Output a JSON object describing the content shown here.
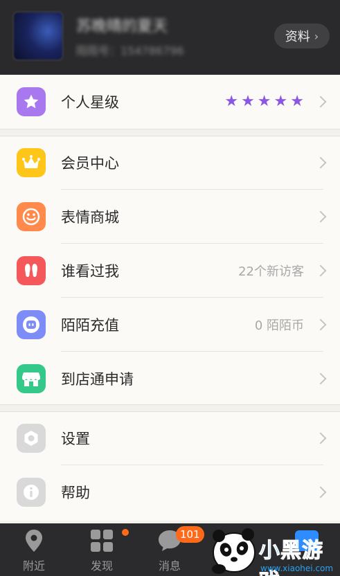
{
  "header": {
    "username": "苏晚晴的夏天",
    "user_id": "陌陌号：154786796",
    "profile_button": "资料"
  },
  "menu": {
    "star_level": {
      "label": "个人星级",
      "stars": 5
    },
    "vip_center": {
      "label": "会员中心"
    },
    "sticker_store": {
      "label": "表情商城"
    },
    "who_viewed": {
      "label": "谁看过我",
      "value": "22个新访客"
    },
    "recharge": {
      "label": "陌陌充值",
      "value": "0 陌陌币"
    },
    "store_apply": {
      "label": "到店通申请"
    },
    "settings": {
      "label": "设置"
    },
    "help": {
      "label": "帮助"
    }
  },
  "tabbar": {
    "nearby": "附近",
    "discover": "发现",
    "messages": "消息",
    "messages_badge": "101"
  },
  "watermark": {
    "brand": "小黑游戏",
    "url": "www.xiaohei.com"
  },
  "colors": {
    "star": "#8a56e2",
    "vip": "#ffc61a",
    "sticker": "#ff8a4c",
    "who_viewed": "#f4585b",
    "recharge": "#7d8cf6",
    "store": "#34c98a",
    "settings": "#d9d9d9",
    "help": "#d9d9d9",
    "badge": "#ff6a1a"
  }
}
